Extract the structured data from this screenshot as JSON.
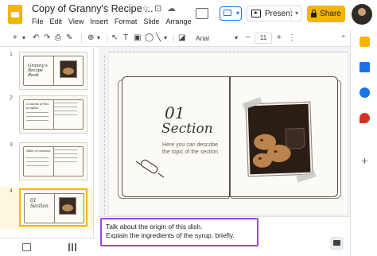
{
  "header": {
    "doc_title": "Copy of Granny's Recipe ...",
    "menu": [
      "File",
      "Edit",
      "View",
      "Insert",
      "Format",
      "Slide",
      "Arrange"
    ],
    "present_label": "Present",
    "share_label": "Share"
  },
  "toolbar": {
    "font": "Arial",
    "font_size": "11"
  },
  "filmstrip": {
    "slides": [
      {
        "number": "1",
        "title": "Granny's Recipe Book"
      },
      {
        "number": "2",
        "title": "Contents of this template"
      },
      {
        "number": "3",
        "title": "Table of contents"
      },
      {
        "number": "4",
        "title": "01 Section"
      }
    ]
  },
  "slide": {
    "section_number": "01",
    "section_title": "Section",
    "description": "Here you can describe the topic of the section"
  },
  "notes": {
    "line1": "Talk about the origin of this dish.",
    "line2": "Explain the ingredients of the syrup, briefly."
  },
  "colors": {
    "accent": "#f4b400",
    "notes_highlight": "#a142f4",
    "present_mode": "#1a73e8"
  }
}
